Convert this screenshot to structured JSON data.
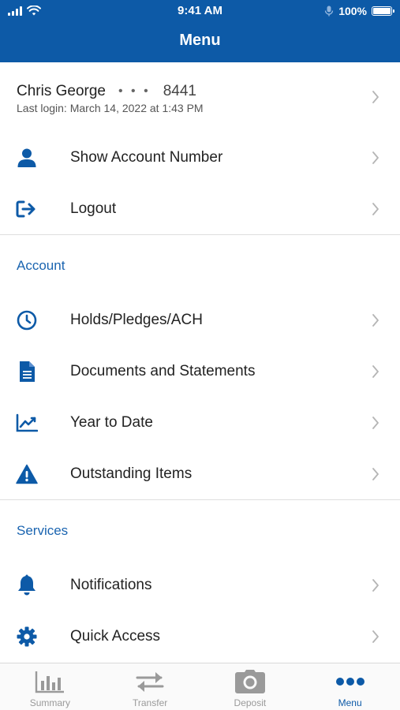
{
  "status_bar": {
    "time": "9:41 AM",
    "battery": "100%"
  },
  "header": {
    "title": "Menu"
  },
  "profile": {
    "name": "Chris George",
    "masked_dots": "• • •",
    "account_suffix": "8441",
    "last_login": "Last login: March 14, 2022 at 1:43 PM"
  },
  "top_items": [
    {
      "label": "Show Account Number",
      "icon": "user-icon"
    },
    {
      "label": "Logout",
      "icon": "logout-icon"
    }
  ],
  "account_section": {
    "title": "Account",
    "items": [
      {
        "label": "Holds/Pledges/ACH",
        "icon": "clock-icon"
      },
      {
        "label": "Documents and Statements",
        "icon": "document-icon"
      },
      {
        "label": "Year to Date",
        "icon": "chart-icon"
      },
      {
        "label": "Outstanding Items",
        "icon": "warning-icon"
      }
    ]
  },
  "services_section": {
    "title": "Services",
    "items": [
      {
        "label": "Notifications",
        "icon": "bell-icon"
      },
      {
        "label": "Quick Access",
        "icon": "gear-icon"
      }
    ]
  },
  "tab_bar": {
    "tabs": [
      {
        "label": "Summary",
        "icon": "bar-chart-icon",
        "active": false
      },
      {
        "label": "Transfer",
        "icon": "transfer-icon",
        "active": false
      },
      {
        "label": "Deposit",
        "icon": "camera-icon",
        "active": false
      },
      {
        "label": "Menu",
        "icon": "more-icon",
        "active": true
      }
    ]
  },
  "colors": {
    "brand": "#0d5aa7",
    "section_title": "#1a64b0",
    "inactive_tab": "#9a9a9a"
  }
}
